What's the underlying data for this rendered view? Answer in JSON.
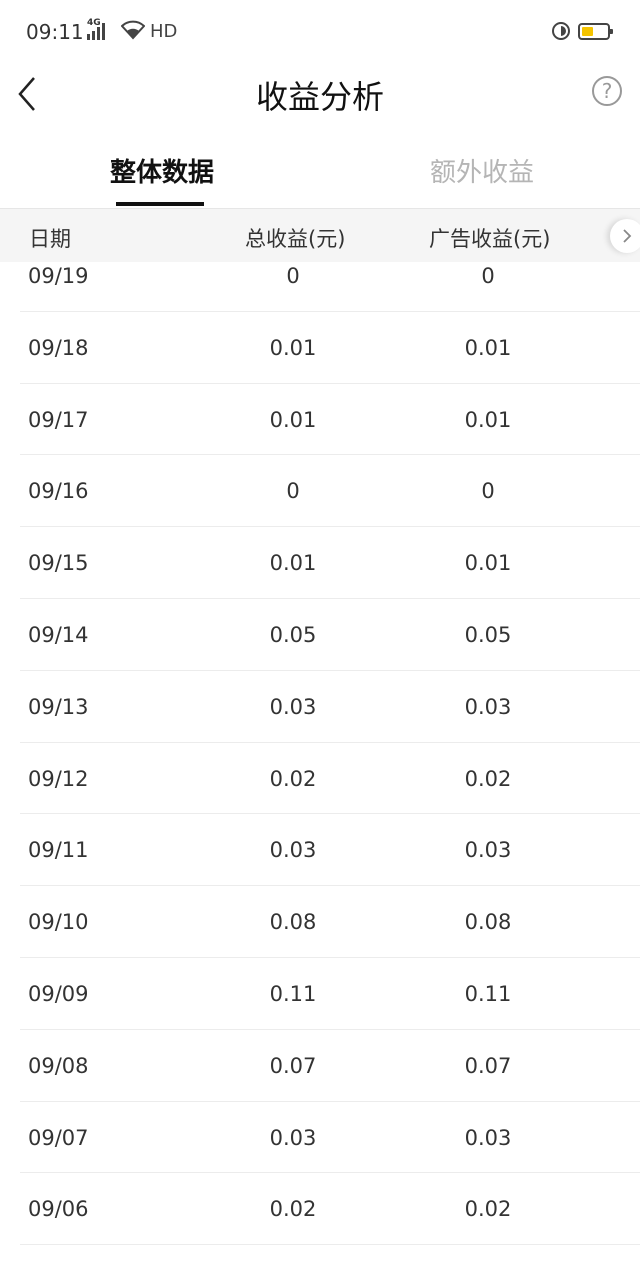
{
  "status_bar": {
    "time": "09:11",
    "network": "4G",
    "hd": "HD",
    "battery_level": 0.45,
    "battery_color": "#f5c400"
  },
  "nav": {
    "title": "收益分析",
    "help": "?"
  },
  "tabs": [
    {
      "label": "整体数据",
      "active": true
    },
    {
      "label": "额外收益",
      "active": false
    }
  ],
  "table": {
    "headers": [
      "日期",
      "总收益(元)",
      "广告收益(元)"
    ],
    "rows": [
      {
        "date": "09/19",
        "total": "0",
        "ad": "0"
      },
      {
        "date": "09/18",
        "total": "0.01",
        "ad": "0.01"
      },
      {
        "date": "09/17",
        "total": "0.01",
        "ad": "0.01"
      },
      {
        "date": "09/16",
        "total": "0",
        "ad": "0"
      },
      {
        "date": "09/15",
        "total": "0.01",
        "ad": "0.01"
      },
      {
        "date": "09/14",
        "total": "0.05",
        "ad": "0.05"
      },
      {
        "date": "09/13",
        "total": "0.03",
        "ad": "0.03"
      },
      {
        "date": "09/12",
        "total": "0.02",
        "ad": "0.02"
      },
      {
        "date": "09/11",
        "total": "0.03",
        "ad": "0.03"
      },
      {
        "date": "09/10",
        "total": "0.08",
        "ad": "0.08"
      },
      {
        "date": "09/09",
        "total": "0.11",
        "ad": "0.11"
      },
      {
        "date": "09/08",
        "total": "0.07",
        "ad": "0.07"
      },
      {
        "date": "09/07",
        "total": "0.03",
        "ad": "0.03"
      },
      {
        "date": "09/06",
        "total": "0.02",
        "ad": "0.02"
      }
    ]
  }
}
